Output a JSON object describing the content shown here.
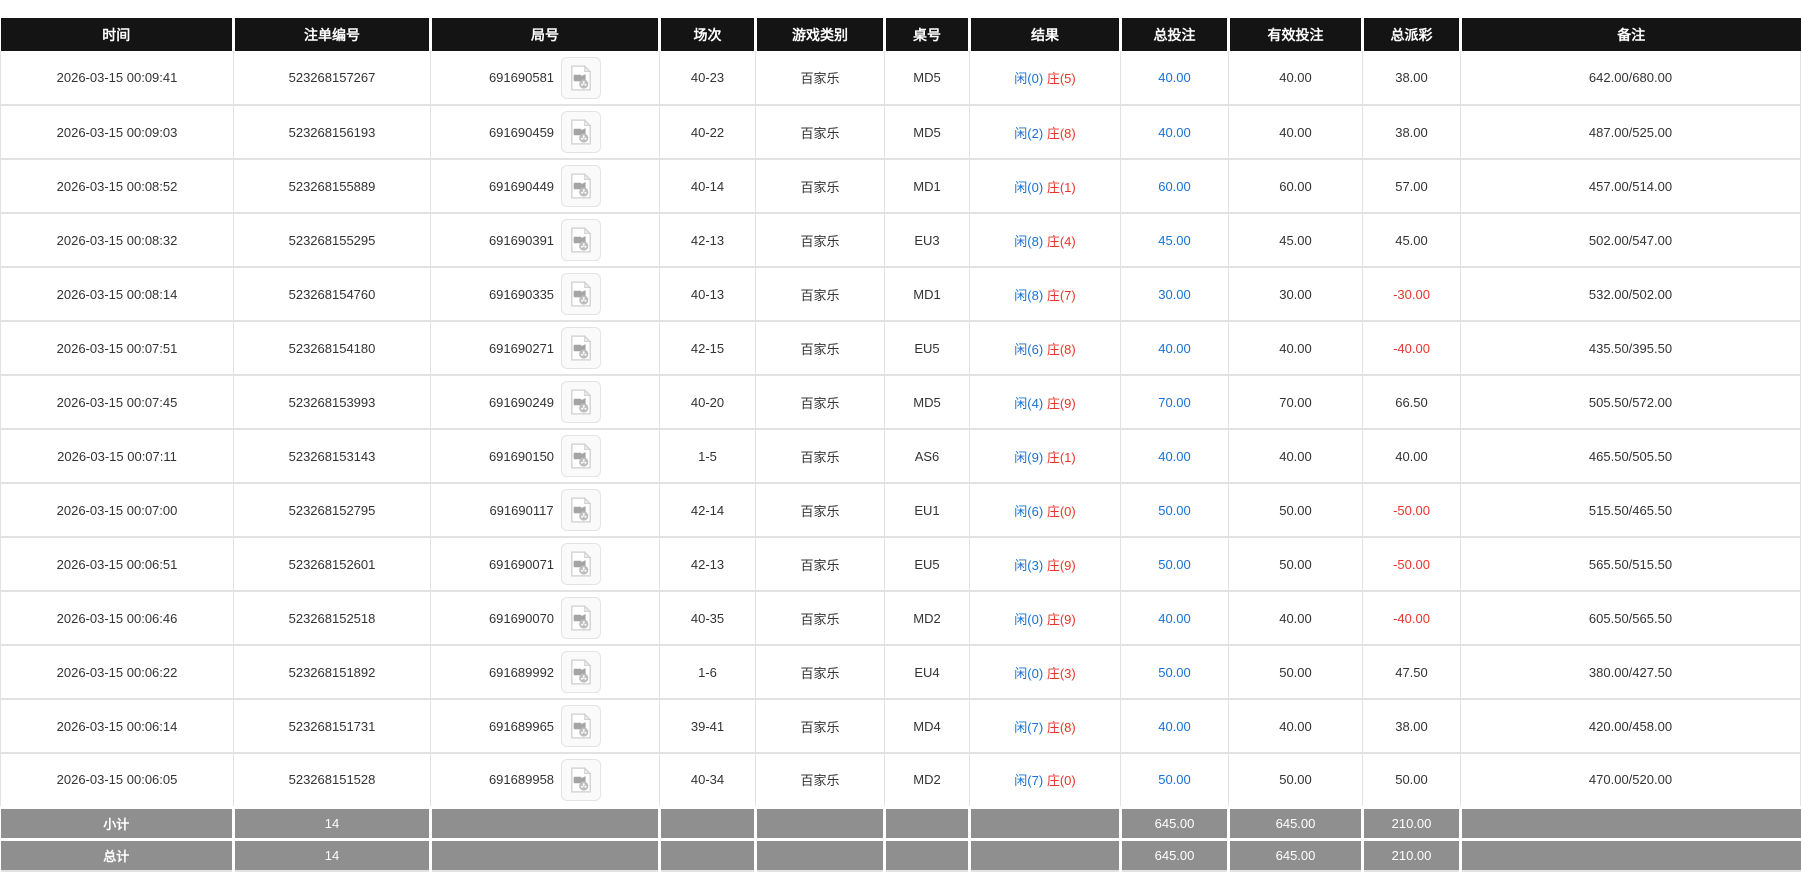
{
  "table": {
    "columns": [
      {
        "label": "时间"
      },
      {
        "label": "注单编号"
      },
      {
        "label": "局号"
      },
      {
        "label": "场次"
      },
      {
        "label": "游戏类别"
      },
      {
        "label": "桌号"
      },
      {
        "label": "结果"
      },
      {
        "label": "总投注"
      },
      {
        "label": "有效投注"
      },
      {
        "label": "总派彩"
      },
      {
        "label": "备注"
      }
    ],
    "rows": [
      {
        "time": "2026-03-15 00:09:41",
        "bet_id": "523268157267",
        "round_id": "691690581",
        "session": "40-23",
        "game_type": "百家乐",
        "table_id": "MD5",
        "result_player": "闲(0)",
        "result_banker": "庄(5)",
        "total_bet": "40.00",
        "valid_bet": "40.00",
        "payout": "38.00",
        "remark": "642.00/680.00"
      },
      {
        "time": "2026-03-15 00:09:03",
        "bet_id": "523268156193",
        "round_id": "691690459",
        "session": "40-22",
        "game_type": "百家乐",
        "table_id": "MD5",
        "result_player": "闲(2)",
        "result_banker": "庄(8)",
        "total_bet": "40.00",
        "valid_bet": "40.00",
        "payout": "38.00",
        "remark": "487.00/525.00"
      },
      {
        "time": "2026-03-15 00:08:52",
        "bet_id": "523268155889",
        "round_id": "691690449",
        "session": "40-14",
        "game_type": "百家乐",
        "table_id": "MD1",
        "result_player": "闲(0)",
        "result_banker": "庄(1)",
        "total_bet": "60.00",
        "valid_bet": "60.00",
        "payout": "57.00",
        "remark": "457.00/514.00"
      },
      {
        "time": "2026-03-15 00:08:32",
        "bet_id": "523268155295",
        "round_id": "691690391",
        "session": "42-13",
        "game_type": "百家乐",
        "table_id": "EU3",
        "result_player": "闲(8)",
        "result_banker": "庄(4)",
        "total_bet": "45.00",
        "valid_bet": "45.00",
        "payout": "45.00",
        "remark": "502.00/547.00"
      },
      {
        "time": "2026-03-15 00:08:14",
        "bet_id": "523268154760",
        "round_id": "691690335",
        "session": "40-13",
        "game_type": "百家乐",
        "table_id": "MD1",
        "result_player": "闲(8)",
        "result_banker": "庄(7)",
        "total_bet": "30.00",
        "valid_bet": "30.00",
        "payout": "-30.00",
        "remark": "532.00/502.00"
      },
      {
        "time": "2026-03-15 00:07:51",
        "bet_id": "523268154180",
        "round_id": "691690271",
        "session": "42-15",
        "game_type": "百家乐",
        "table_id": "EU5",
        "result_player": "闲(6)",
        "result_banker": "庄(8)",
        "total_bet": "40.00",
        "valid_bet": "40.00",
        "payout": "-40.00",
        "remark": "435.50/395.50"
      },
      {
        "time": "2026-03-15 00:07:45",
        "bet_id": "523268153993",
        "round_id": "691690249",
        "session": "40-20",
        "game_type": "百家乐",
        "table_id": "MD5",
        "result_player": "闲(4)",
        "result_banker": "庄(9)",
        "total_bet": "70.00",
        "valid_bet": "70.00",
        "payout": "66.50",
        "remark": "505.50/572.00"
      },
      {
        "time": "2026-03-15 00:07:11",
        "bet_id": "523268153143",
        "round_id": "691690150",
        "session": "1-5",
        "game_type": "百家乐",
        "table_id": "AS6",
        "result_player": "闲(9)",
        "result_banker": "庄(1)",
        "total_bet": "40.00",
        "valid_bet": "40.00",
        "payout": "40.00",
        "remark": "465.50/505.50"
      },
      {
        "time": "2026-03-15 00:07:00",
        "bet_id": "523268152795",
        "round_id": "691690117",
        "session": "42-14",
        "game_type": "百家乐",
        "table_id": "EU1",
        "result_player": "闲(6)",
        "result_banker": "庄(0)",
        "total_bet": "50.00",
        "valid_bet": "50.00",
        "payout": "-50.00",
        "remark": "515.50/465.50"
      },
      {
        "time": "2026-03-15 00:06:51",
        "bet_id": "523268152601",
        "round_id": "691690071",
        "session": "42-13",
        "game_type": "百家乐",
        "table_id": "EU5",
        "result_player": "闲(3)",
        "result_banker": "庄(9)",
        "total_bet": "50.00",
        "valid_bet": "50.00",
        "payout": "-50.00",
        "remark": "565.50/515.50"
      },
      {
        "time": "2026-03-15 00:06:46",
        "bet_id": "523268152518",
        "round_id": "691690070",
        "session": "40-35",
        "game_type": "百家乐",
        "table_id": "MD2",
        "result_player": "闲(0)",
        "result_banker": "庄(9)",
        "total_bet": "40.00",
        "valid_bet": "40.00",
        "payout": "-40.00",
        "remark": "605.50/565.50"
      },
      {
        "time": "2026-03-15 00:06:22",
        "bet_id": "523268151892",
        "round_id": "691689992",
        "session": "1-6",
        "game_type": "百家乐",
        "table_id": "EU4",
        "result_player": "闲(0)",
        "result_banker": "庄(3)",
        "total_bet": "50.00",
        "valid_bet": "50.00",
        "payout": "47.50",
        "remark": "380.00/427.50"
      },
      {
        "time": "2026-03-15 00:06:14",
        "bet_id": "523268151731",
        "round_id": "691689965",
        "session": "39-41",
        "game_type": "百家乐",
        "table_id": "MD4",
        "result_player": "闲(7)",
        "result_banker": "庄(8)",
        "total_bet": "40.00",
        "valid_bet": "40.00",
        "payout": "38.00",
        "remark": "420.00/458.00"
      },
      {
        "time": "2026-03-15 00:06:05",
        "bet_id": "523268151528",
        "round_id": "691689958",
        "session": "40-34",
        "game_type": "百家乐",
        "table_id": "MD2",
        "result_player": "闲(7)",
        "result_banker": "庄(0)",
        "total_bet": "50.00",
        "valid_bet": "50.00",
        "payout": "50.00",
        "remark": "470.00/520.00"
      }
    ],
    "footer": [
      {
        "label": "小计",
        "count": "14",
        "total_bet": "645.00",
        "valid_bet": "645.00",
        "payout": "210.00"
      },
      {
        "label": "总计",
        "count": "14",
        "total_bet": "645.00",
        "valid_bet": "645.00",
        "payout": "210.00"
      }
    ]
  },
  "icons": {
    "video": "video-file-icon"
  },
  "colors": {
    "header_bg": "#141414",
    "footer_bg": "#8f8f8f",
    "link_blue": "#1a71d2",
    "result_player_blue": "#1a71d2",
    "result_banker_red": "#e8352b",
    "negative_red": "#e8352b",
    "row_border": "#e2e2e2"
  }
}
